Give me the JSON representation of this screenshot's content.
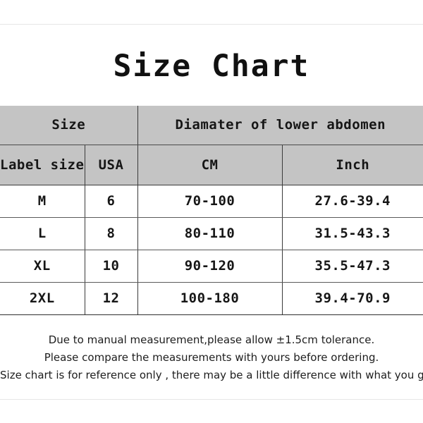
{
  "title": "Size Chart",
  "table": {
    "group_headers": [
      {
        "label": "Size",
        "span": 2
      },
      {
        "label": "Diamater of lower abdomen",
        "span": 2
      }
    ],
    "columns": [
      "Label size",
      "USA",
      "CM",
      "Inch"
    ],
    "rows": [
      {
        "label_size": "M",
        "usa": "6",
        "cm": "70-100",
        "inch": "27.6-39.4"
      },
      {
        "label_size": "L",
        "usa": "8",
        "cm": "80-110",
        "inch": "31.5-43.3"
      },
      {
        "label_size": "XL",
        "usa": "10",
        "cm": "90-120",
        "inch": "35.5-47.3"
      },
      {
        "label_size": "2XL",
        "usa": "12",
        "cm": "100-180",
        "inch": "39.4-70.9"
      }
    ],
    "header_bg": "#c4c4c4",
    "body_bg": "#ffffff",
    "border_color": "#3a3a3a"
  },
  "notes": [
    "Due to manual measurement,please allow ±1.5cm tolerance.",
    "Please compare the measurements with yours before ordering.",
    "Size chart is for reference only , there may be a little difference with what you get."
  ]
}
